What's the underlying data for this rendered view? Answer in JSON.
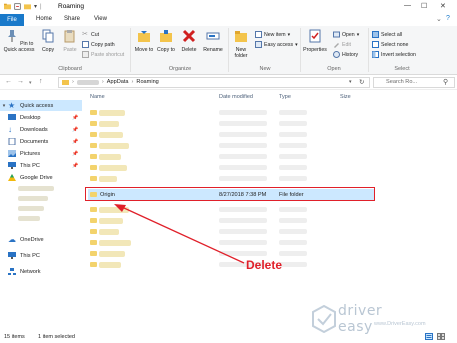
{
  "window": {
    "title": "Roaming"
  },
  "tabs": [
    {
      "label": "File"
    },
    {
      "label": "Home"
    },
    {
      "label": "Share"
    },
    {
      "label": "View"
    }
  ],
  "ribbon": {
    "clipboard": {
      "pin_label": "Pin to Quick access",
      "copy_label": "Copy",
      "paste_label": "Paste",
      "cut_label": "Cut",
      "copy_path_label": "Copy path",
      "paste_shortcut_label": "Paste shortcut",
      "group_label": "Clipboard"
    },
    "organize": {
      "move_label": "Move to",
      "copy_label": "Copy to",
      "delete_label": "Delete",
      "rename_label": "Rename",
      "group_label": "Organize"
    },
    "new": {
      "new_folder_label": "New folder",
      "new_item_label": "New item",
      "easy_access_label": "Easy access",
      "group_label": "New"
    },
    "open": {
      "properties_label": "Properties",
      "open_label": "Open",
      "edit_label": "Edit",
      "history_label": "History",
      "group_label": "Open"
    },
    "select": {
      "select_all_label": "Select all",
      "select_none_label": "Select none",
      "invert_label": "Invert selection",
      "group_label": "Select"
    }
  },
  "address": {
    "crumbs": [
      "AppData",
      "Roaming"
    ],
    "search_placeholder": "Search Ro..."
  },
  "nav": {
    "items": [
      {
        "label": "Quick access"
      },
      {
        "label": "Desktop"
      },
      {
        "label": "Downloads"
      },
      {
        "label": "Documents"
      },
      {
        "label": "Pictures"
      },
      {
        "label": "This PC"
      },
      {
        "label": "Google Drive"
      },
      {
        "label": "OneDrive"
      },
      {
        "label": "This PC"
      },
      {
        "label": "Network"
      }
    ]
  },
  "columns": {
    "name": "Name",
    "date": "Date modified",
    "type": "Type",
    "size": "Size"
  },
  "selected_row": {
    "name": "Origin",
    "date": "8/27/2018 7:38 PM",
    "type": "File folder"
  },
  "annotation": {
    "label": "Delete"
  },
  "status": {
    "count": "15 items",
    "selected": "1 item selected"
  },
  "watermark": {
    "brand": "driver easy",
    "url": "www.DriverEasy.com"
  },
  "colors": {
    "accent": "#1979ca",
    "highlight": "#e0202a",
    "selection": "#cce8ff"
  }
}
